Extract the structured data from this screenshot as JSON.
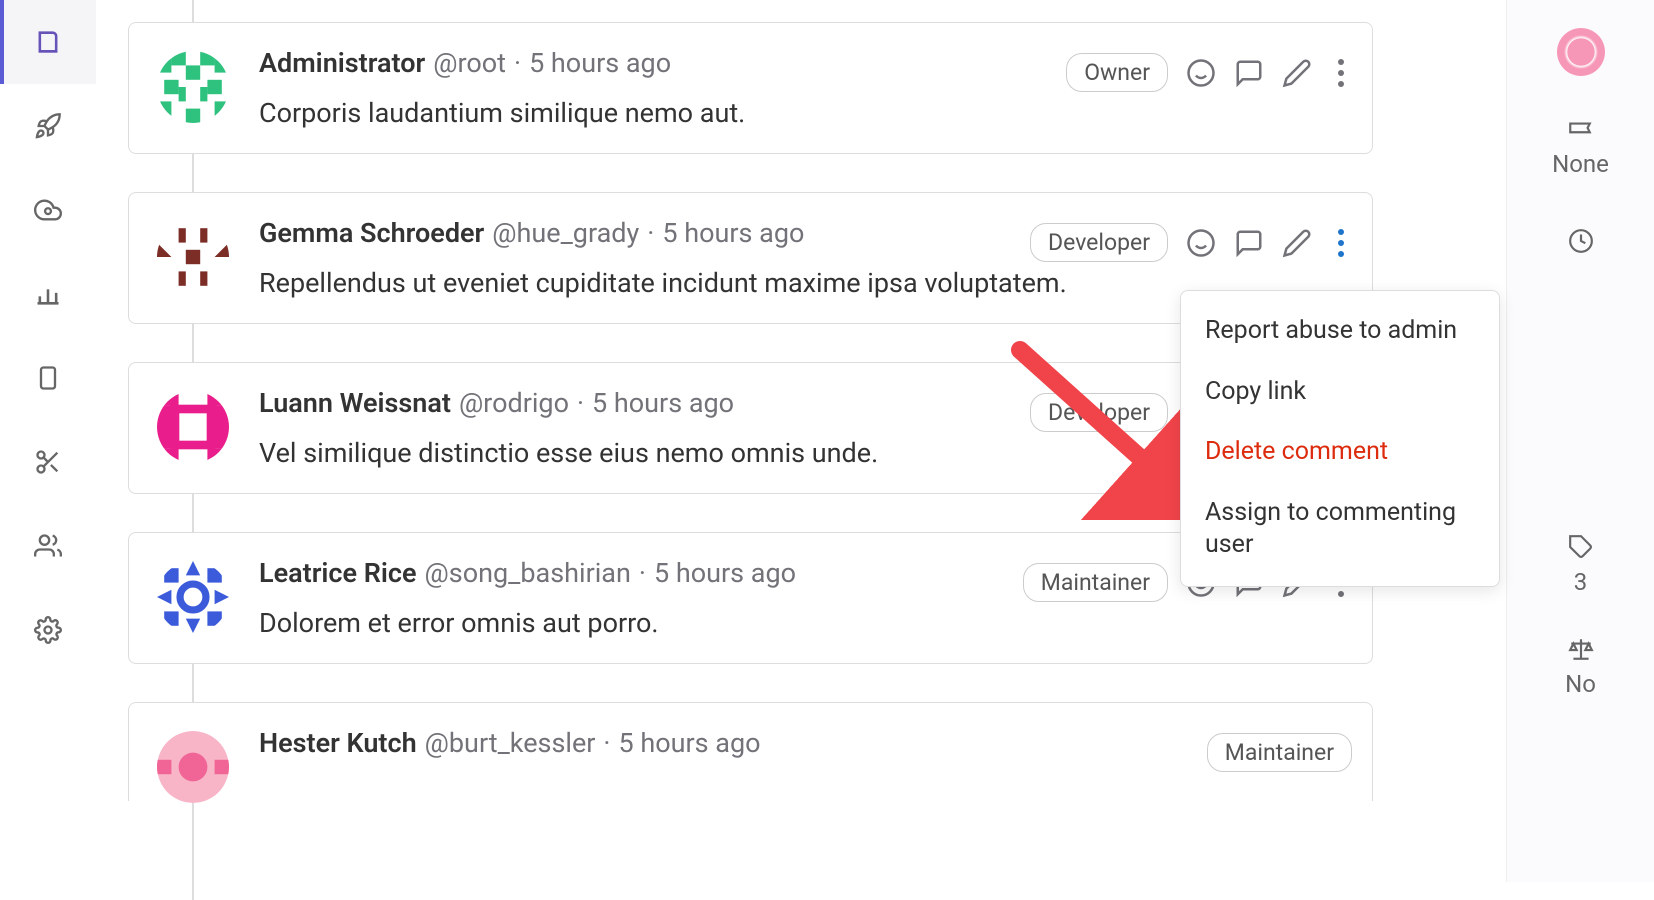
{
  "sidebar": {
    "items": [
      {
        "name": "project-icon"
      },
      {
        "name": "rocket-icon"
      },
      {
        "name": "cloud-download-icon"
      },
      {
        "name": "chart-icon"
      },
      {
        "name": "book-icon"
      },
      {
        "name": "scissors-icon"
      },
      {
        "name": "users-icon"
      },
      {
        "name": "gear-icon"
      }
    ]
  },
  "comments": [
    {
      "author": "Administrator",
      "username": "@root",
      "time": "5 hours ago",
      "role": "Owner",
      "body": "Corporis laudantium similique nemo aut.",
      "avatar_bg": "#fff",
      "avatar_fg": "#2ec27e"
    },
    {
      "author": "Gemma Schroeder",
      "username": "@hue_grady",
      "time": "5 hours ago",
      "role": "Developer",
      "body": "Repellendus ut eveniet cupiditate incidunt maxime ipsa voluptatem.",
      "avatar_bg": "#fff",
      "avatar_fg": "#7b2d26"
    },
    {
      "author": "Luann Weissnat",
      "username": "@rodrigo",
      "time": "5 hours ago",
      "role": "Developer",
      "body": "Vel similique distinctio esse eius nemo omnis unde.",
      "avatar_bg": "#fff",
      "avatar_fg": "#e91e8c"
    },
    {
      "author": "Leatrice Rice",
      "username": "@song_bashirian",
      "time": "5 hours ago",
      "role": "Maintainer",
      "body": "Dolorem et error omnis aut porro.",
      "avatar_bg": "#fff",
      "avatar_fg": "#3b5bdb"
    },
    {
      "author": "Hester Kutch",
      "username": "@burt_kessler",
      "time": "5 hours ago",
      "role": "Maintainer",
      "body": "",
      "avatar_bg": "#fff",
      "avatar_fg": "#f783ac"
    }
  ],
  "dropdown": {
    "report": "Report abuse to admin",
    "copy": "Copy link",
    "delete": "Delete comment",
    "assign": "Assign to commenting user"
  },
  "rightPanel": {
    "none": "None",
    "count": "3",
    "no": "No"
  }
}
